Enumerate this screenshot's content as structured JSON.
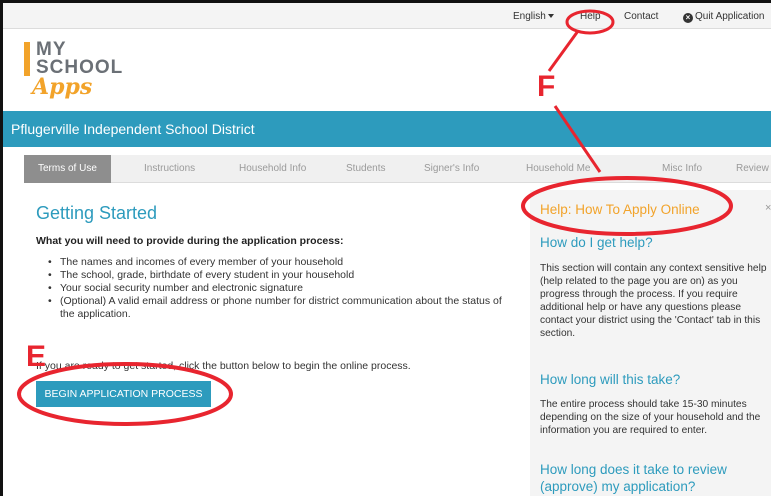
{
  "topbar": {
    "language": "English",
    "help": "Help",
    "contact": "Contact",
    "quit": "Quit Application"
  },
  "logo": {
    "line1": "MY",
    "line2": "SCHOOL",
    "line3": "Apps"
  },
  "district": "Pflugerville Independent School District",
  "tabs": [
    "Terms of Use",
    "Instructions",
    "Household Info",
    "Students",
    "Signer's Info",
    "Household Me",
    "Misc Info",
    "Review"
  ],
  "main": {
    "title": "Getting Started",
    "need_heading": "What you will need to provide during the application process:",
    "bullets": [
      "The names and incomes of every member of your household",
      "The school, grade, birthdate of every student in your household",
      "Your social security number and electronic signature",
      "(Optional) A valid email address or phone number for district communication about the status of the application."
    ],
    "ready_text": "If you are ready to get started, click the button below to begin the online process.",
    "button": "BEGIN APPLICATION PROCESS"
  },
  "help_panel": {
    "title": "Help: How To Apply Online",
    "close": "×",
    "q1": "How do I get help?",
    "a1": "This section will contain any context sensitive help (help related to the page you are on) as you progress through the process. If you require additional help or have any questions please contact your district using the 'Contact' tab in this section.",
    "q2": "How long will this take?",
    "a2": "The entire process should take 15-30 minutes depending on the size of your household and the information you are required to enter.",
    "q3": "How long does it take to review (approve) my application?"
  },
  "annotations": {
    "label_f": "F",
    "label_e": "E",
    "color": "#e8252f"
  },
  "colors": {
    "brand_teal": "#2d9bbd",
    "brand_orange": "#f2a32a"
  }
}
